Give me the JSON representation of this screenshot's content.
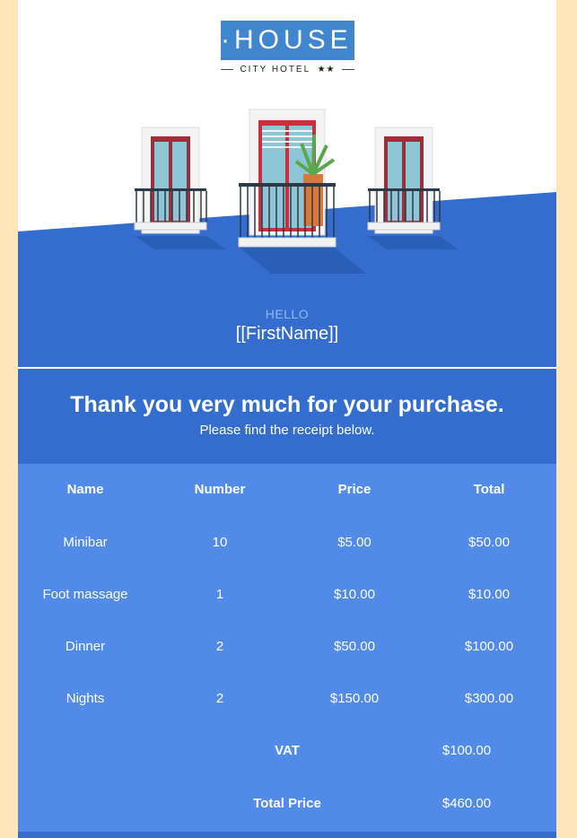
{
  "logo": {
    "name": "HOUSE",
    "subtitle": "CITY HOTEL",
    "stars": "★★"
  },
  "greeting": {
    "hello": "HELLO",
    "first_name": "[[FirstName]]"
  },
  "thanks": {
    "title": "Thank you very much for your purchase.",
    "subtitle": "Please find the receipt below."
  },
  "receipt": {
    "headers": [
      "Name",
      "Number",
      "Price",
      "Total"
    ],
    "rows": [
      [
        "Minibar",
        "10",
        "$5.00",
        "$50.00"
      ],
      [
        "Foot massage",
        "1",
        "$10.00",
        "$10.00"
      ],
      [
        "Dinner",
        "2",
        "$50.00",
        "$100.00"
      ],
      [
        "Nights",
        "2",
        "$150.00",
        "$300.00"
      ]
    ],
    "vat_label": "VAT",
    "vat_value": "$100.00",
    "total_label": "Total Price",
    "total_value": "$460.00"
  },
  "colors": {
    "page_bg": "#fde7b8",
    "brand_blue": "#3f86cf",
    "hero_blue": "#356dce",
    "table_blue": "#528ae8",
    "hello_text": "#8fbaf5"
  }
}
